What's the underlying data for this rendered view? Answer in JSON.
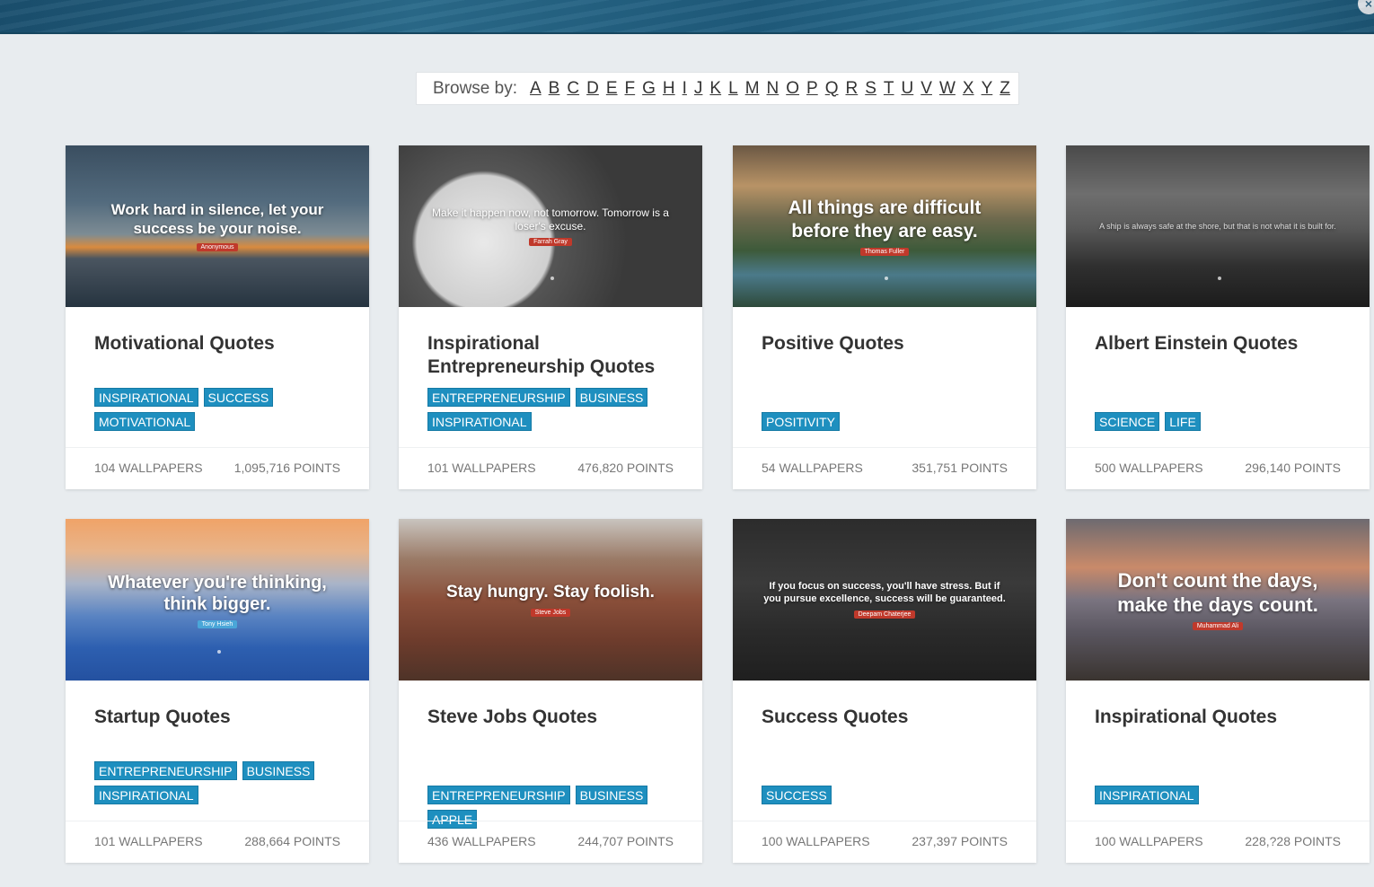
{
  "browse": {
    "label": "Browse by:",
    "letters": [
      "A",
      "B",
      "C",
      "D",
      "E",
      "F",
      "G",
      "H",
      "I",
      "J",
      "K",
      "L",
      "M",
      "N",
      "O",
      "P",
      "Q",
      "R",
      "S",
      "T",
      "U",
      "V",
      "W",
      "X",
      "Y",
      "Z"
    ]
  },
  "cards": [
    {
      "title": "Motivational Quotes",
      "thumb_quote": "Work hard in silence, let your success be your noise.",
      "thumb_author": "Anonymous",
      "tags": [
        "INSPIRATIONAL",
        "SUCCESS",
        "MOTIVATIONAL"
      ],
      "wallpapers": "104 WALLPAPERS",
      "points": "1,095,716 POINTS"
    },
    {
      "title": "Inspirational Entrepreneurship Quotes",
      "thumb_quote": "Make it happen now, not tomorrow. Tomorrow is a loser's excuse.",
      "thumb_author": "Farrah Gray",
      "tags": [
        "ENTREPRENEURSHIP",
        "BUSINESS",
        "INSPIRATIONAL"
      ],
      "wallpapers": "101 WALLPAPERS",
      "points": "476,820 POINTS"
    },
    {
      "title": "Positive Quotes",
      "thumb_quote": "All things are difficult before they are easy.",
      "thumb_author": "Thomas Fuller",
      "tags": [
        "POSITIVITY"
      ],
      "wallpapers": "54 WALLPAPERS",
      "points": "351,751 POINTS"
    },
    {
      "title": "Albert Einstein Quotes",
      "thumb_quote": "A ship is always safe at the shore, but that is not what it is built for.",
      "thumb_author": "",
      "tags": [
        "SCIENCE",
        "LIFE"
      ],
      "wallpapers": "500 WALLPAPERS",
      "points": "296,140 POINTS"
    },
    {
      "title": "Startup Quotes",
      "thumb_quote": "Whatever you're thinking, think bigger.",
      "thumb_author": "Tony Hsieh",
      "tags": [
        "ENTREPRENEURSHIP",
        "BUSINESS",
        "INSPIRATIONAL"
      ],
      "wallpapers": "101 WALLPAPERS",
      "points": "288,664 POINTS"
    },
    {
      "title": "Steve Jobs Quotes",
      "thumb_quote": "Stay hungry. Stay foolish.",
      "thumb_author": "Steve Jobs",
      "tags": [
        "ENTREPRENEURSHIP",
        "BUSINESS",
        "APPLE"
      ],
      "wallpapers": "436 WALLPAPERS",
      "points": "244,707 POINTS"
    },
    {
      "title": "Success Quotes",
      "thumb_quote": "If you focus on success, you'll have stress. But if you pursue excellence, success will be guaranteed.",
      "thumb_author": "Deepam Chaterjee",
      "tags": [
        "SUCCESS"
      ],
      "wallpapers": "100 WALLPAPERS",
      "points": "237,397 POINTS"
    },
    {
      "title": "Inspirational Quotes",
      "thumb_quote": "Don't count the days, make the days count.",
      "thumb_author": "Muhammad Ali",
      "tags": [
        "INSPIRATIONAL"
      ],
      "wallpapers": "100 WALLPAPERS",
      "points": "228,?28 POINTS"
    }
  ]
}
